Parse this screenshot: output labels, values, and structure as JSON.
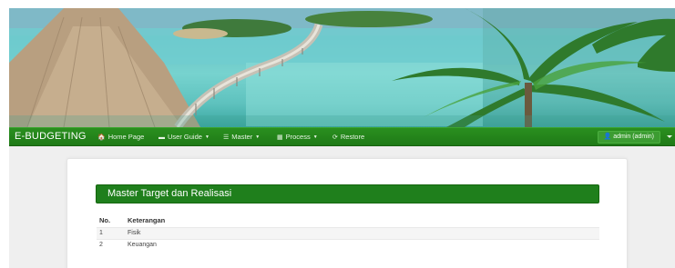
{
  "navbar": {
    "brand": "E-BUDGETING",
    "items": [
      {
        "label": "Home Page",
        "icon": "home-icon",
        "glyph": "🏠",
        "dropdown": false
      },
      {
        "label": "User Guide",
        "icon": "comment-icon",
        "glyph": "▬",
        "dropdown": true
      },
      {
        "label": "Master",
        "icon": "list-icon",
        "glyph": "☰",
        "dropdown": true
      },
      {
        "label": "Process",
        "icon": "grid-icon",
        "glyph": "▦",
        "dropdown": true
      },
      {
        "label": "Restore",
        "icon": "refresh-icon",
        "glyph": "⟳",
        "dropdown": false
      }
    ],
    "user": {
      "label": "admin (admin)",
      "icon": "user-icon",
      "glyph": "👤"
    }
  },
  "panel": {
    "title": "Master Target dan Realisasi"
  },
  "table": {
    "headers": [
      "No.",
      "Keterangan"
    ],
    "rows": [
      [
        "1",
        "Fisik"
      ],
      [
        "2",
        "Keuangan"
      ]
    ]
  },
  "colors": {
    "navbar": "#1f7a17",
    "panel_header": "#1f7f1c"
  }
}
